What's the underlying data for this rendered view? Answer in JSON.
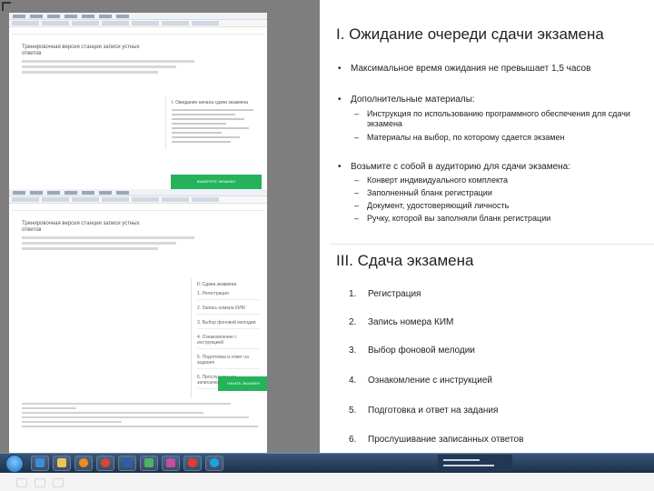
{
  "left_panel": {
    "top_page_title": "Тренировочная версия станции записи устных ответов",
    "top_card_title": "I. Ожидание начала сдачи экзамена",
    "top_button": "ВЫБЕРИТЕ ЭКЗАМЕН",
    "bottom_page_title": "Тренировочная версия станции записи устных ответов",
    "bottom_card_title": "II. Сдача экзамена",
    "bottom_steps": [
      "1. Регистрация",
      "2. Запись номера КИМ",
      "3. Выбор фоновой мелодии",
      "4. Ознакомление с инструкцией",
      "5. Подготовка и ответ на задания",
      "6. Прослушивание записанных ответов"
    ],
    "bottom_button": "НАЧАТЬ ЭКЗАМЕН"
  },
  "slide": {
    "section1_title": "I. Ожидание очереди сдачи экзамена",
    "bullets": [
      {
        "text": "Максимальное время ожидания не превышает 1,5 часов",
        "subs": []
      },
      {
        "text": "Дополнительные материалы:",
        "subs": [
          "Инструкция по использованию программного обеспечения для сдачи экзамена",
          "Материалы на выбор, по которому сдается экзамен"
        ]
      },
      {
        "text": "Возьмите с собой в аудиторию для сдачи экзамена:",
        "subs": [
          "Конверт индивидуального комплекта",
          "Заполненный бланк регистрации",
          "Документ, удостоверяющий личность",
          "Ручку, которой вы заполняли бланк регистрации"
        ]
      }
    ],
    "bullet_symbol": "•",
    "dash_symbol": "–",
    "section2_title": "III. Сдача экзамена",
    "steps": [
      {
        "num": "1.",
        "text": "Регистрация"
      },
      {
        "num": "2.",
        "text": "Запись номера КИМ"
      },
      {
        "num": "3.",
        "text": "Выбор фоновой мелодии"
      },
      {
        "num": "4.",
        "text": "Ознакомление с инструкцией"
      },
      {
        "num": "5.",
        "text": "Подготовка и ответ на задания"
      },
      {
        "num": "6.",
        "text": "Прослушивание записанных ответов"
      }
    ]
  },
  "taskbar": {
    "icons": [
      "start-icon",
      "ie-icon",
      "folder-icon",
      "media-icon",
      "chrome-icon",
      "word-icon",
      "paint-icon",
      "photo-icon",
      "yandex-icon",
      "skype-icon"
    ]
  },
  "colors": {
    "accent_green": "#24b35a",
    "taskbar": "#1d3049"
  }
}
